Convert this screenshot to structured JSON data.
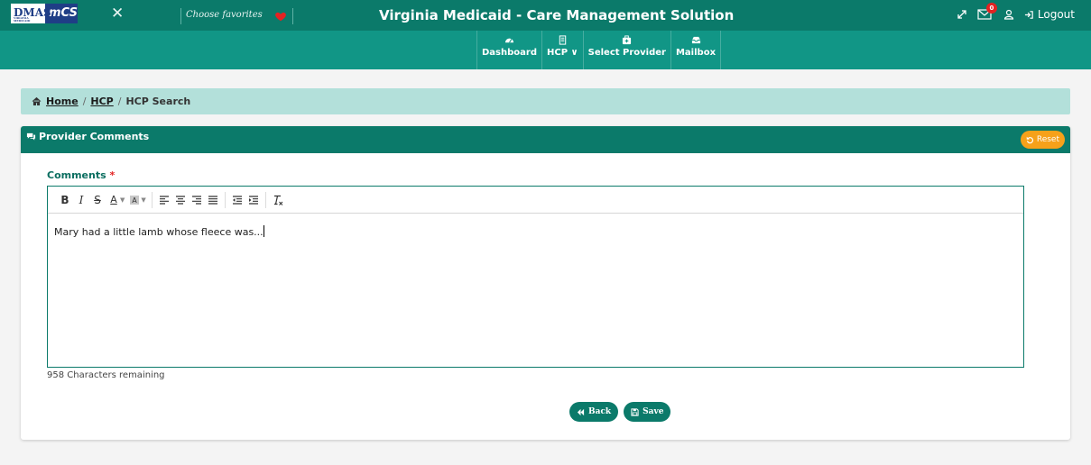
{
  "header": {
    "logo_left": "DMAS",
    "logo_sub": "VIRGINIA MEDICAID",
    "logo_right": "mCS",
    "favorites_placeholder": "Choose favorites",
    "title": "Virginia Medicaid - Care Management Solution",
    "mail_badge": "0",
    "logout_label": "Logout"
  },
  "nav": {
    "items": [
      {
        "label": "Dashboard",
        "icon": "dashboard-icon"
      },
      {
        "label": "HCP ∨",
        "icon": "hcp-icon"
      },
      {
        "label": "Select Provider",
        "icon": "provider-icon"
      },
      {
        "label": "Mailbox",
        "icon": "mailbox-icon"
      }
    ]
  },
  "breadcrumb": {
    "home": "Home",
    "hcp": "HCP",
    "current": "HCP Search",
    "separator": "/"
  },
  "card": {
    "title": "Provider Comments",
    "reset_label": "Reset",
    "field_label": "Comments",
    "required_mark": "*",
    "comment_text": "Mary had a little lamb whose fleece was...",
    "chars_remaining": "958 Characters remaining",
    "back_label": "Back",
    "save_label": "Save"
  },
  "colors": {
    "topbar": "#0b7a6a",
    "navbar": "#119686",
    "breadcrumb_bg": "#b3e0da",
    "reset": "#f6a11a",
    "required": "#e32222"
  }
}
